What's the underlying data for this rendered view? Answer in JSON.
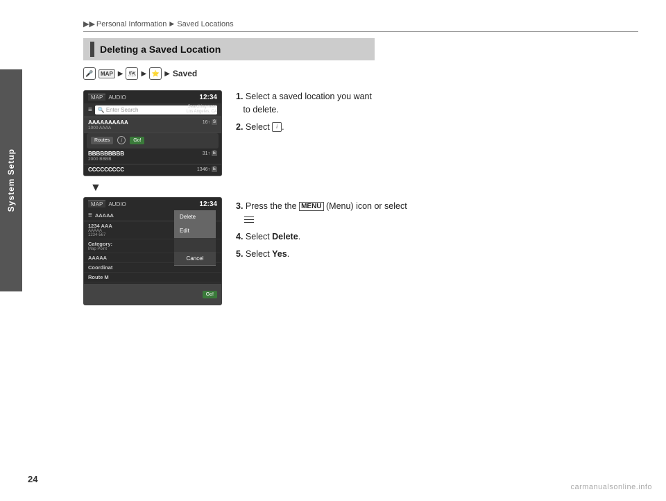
{
  "breadcrumb": {
    "prefix_arrows": "▶▶",
    "part1": "Personal Information",
    "arrow1": "▶",
    "part2": "Saved Locations"
  },
  "sidebar": {
    "label": "System Setup"
  },
  "page_number": "24",
  "watermark": "carmanualsonline.info",
  "section": {
    "title": "Deleting a Saved Location"
  },
  "path": {
    "icon_label": "Q",
    "map_label": "MAP",
    "play1": "▶",
    "play2": "▶",
    "play3": "▶",
    "saved_label": "Saved"
  },
  "screen1": {
    "tab_map": "MAP",
    "tab_audio": "AUDIO",
    "time": "12:34",
    "menu_icon": "≡",
    "search_placeholder": "Enter Search",
    "search_near": "Searching near:",
    "search_location": "Los Angeles, CA",
    "items": [
      {
        "name": "AAAAAAAAAA",
        "sub": "1000 AAAA",
        "dist": "16↑",
        "badge": "S"
      },
      {
        "name": "BBBBBBBBB",
        "sub": "2000 BBBB",
        "dist": "31↑",
        "badge": "E"
      },
      {
        "name": "CCCCCCCCC",
        "sub": "",
        "dist": "1346↑",
        "badge": "E"
      }
    ],
    "popup": {
      "routes_btn": "Routes",
      "info_icon": "i",
      "go_btn": "Go!"
    }
  },
  "screen2": {
    "tab_map": "MAP",
    "tab_audio": "AUDIO",
    "time": "12:34",
    "menu_icon": "≡",
    "items": [
      {
        "name": "AAAAA",
        "sub1": "1234 AAA",
        "sub2": "AAAAA",
        "sub3": "1234-567"
      },
      {
        "name": "Category:",
        "sub1": "Map Point"
      },
      {
        "name": "AAAAA",
        "sub1": ""
      },
      {
        "name": "Coordinat",
        "sub1": ""
      },
      {
        "name": "Route M",
        "sub1": ""
      }
    ],
    "overlay": {
      "delete_label": "Delete",
      "edit_label": "Edit",
      "cancel_label": "Cancel"
    },
    "go_btn": "Go!"
  },
  "instructions": {
    "step1": "Select a saved location you want",
    "step1b": "to delete.",
    "step2_pre": "Select",
    "step2_icon": "i",
    "step3_pre": "Press the",
    "step3_menu": "MENU",
    "step3_post": "(Menu) icon or select",
    "step3_menu2": "≡",
    "step4_pre": "Select",
    "step4_bold": "Delete",
    "step5_pre": "Select",
    "step5_bold": "Yes",
    "step_numbers": [
      "1.",
      "2.",
      "3.",
      "4.",
      "5."
    ]
  }
}
